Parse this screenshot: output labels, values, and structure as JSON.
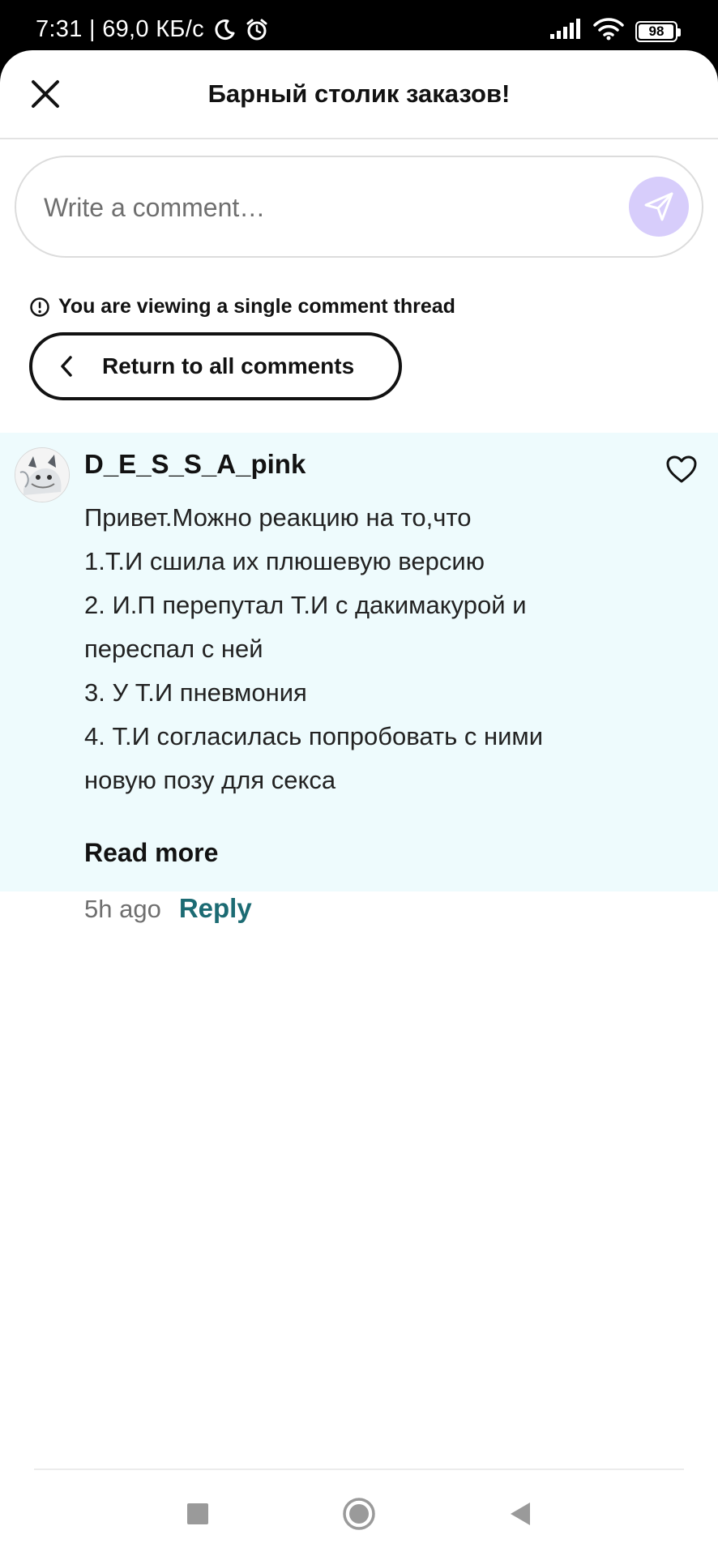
{
  "status_bar": {
    "time_speed": "7:31 | 69,0 КБ/с",
    "icons": [
      "moon-icon",
      "alarm-icon",
      "signal-icon",
      "wifi-icon",
      "battery-icon"
    ],
    "battery": "98",
    "battery_level_percent": 98
  },
  "header": {
    "title": "Барный столик заказов!",
    "close_icon": "close-icon"
  },
  "comment_input": {
    "placeholder": "Write a comment…",
    "send_icon": "send-icon",
    "send_color": "#d7cdfb"
  },
  "thread": {
    "notice": "You are viewing a single comment thread",
    "return_label": "Return to all comments"
  },
  "comment": {
    "author": "D_E_S_S_A_pink",
    "lines": [
      "Привет.Можно реакцию на то,что",
      "1.Т.И сшила их плюшевую версию",
      "2. И.П перепутал Т.И с дакимакурой и",
      "переспал с ней",
      "3. У Т.И пневмония",
      "4. Т.И согласилась попробовать с ними",
      "новую позу для секса"
    ],
    "read_more": "Read more",
    "time": "5h ago",
    "reply": "Reply",
    "background": "#eefbfd",
    "reply_color": "#1c6b73"
  },
  "nav": {
    "icons": [
      "recents-square-icon",
      "home-circle-icon",
      "back-triangle-icon"
    ]
  }
}
